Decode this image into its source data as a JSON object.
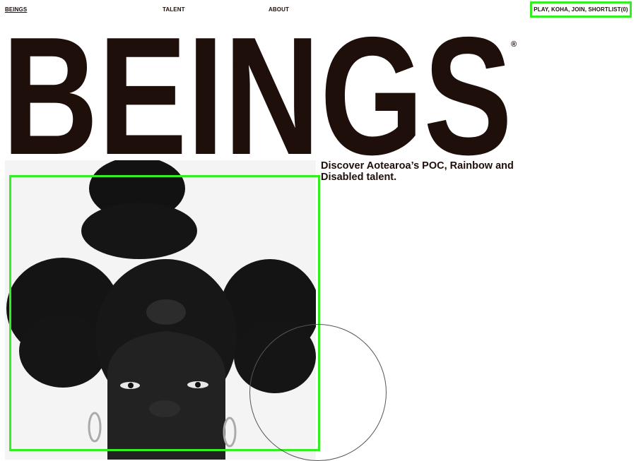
{
  "nav": {
    "logo": "BEINGS",
    "talent": "TALENT",
    "about": "ABOUT",
    "cart": "PLAY, KOHA, JOIN, SHORTLIST(0)"
  },
  "hero": {
    "wordmark": "BEINGS",
    "registered": "®",
    "tagline": "Discover Aotearoa’s POC, Rainbow and Disabled talent."
  },
  "colors": {
    "text": "#1e0f0a",
    "highlight": "#33ee22",
    "background": "#ffffff",
    "photo_background": "#f4f4f4"
  }
}
